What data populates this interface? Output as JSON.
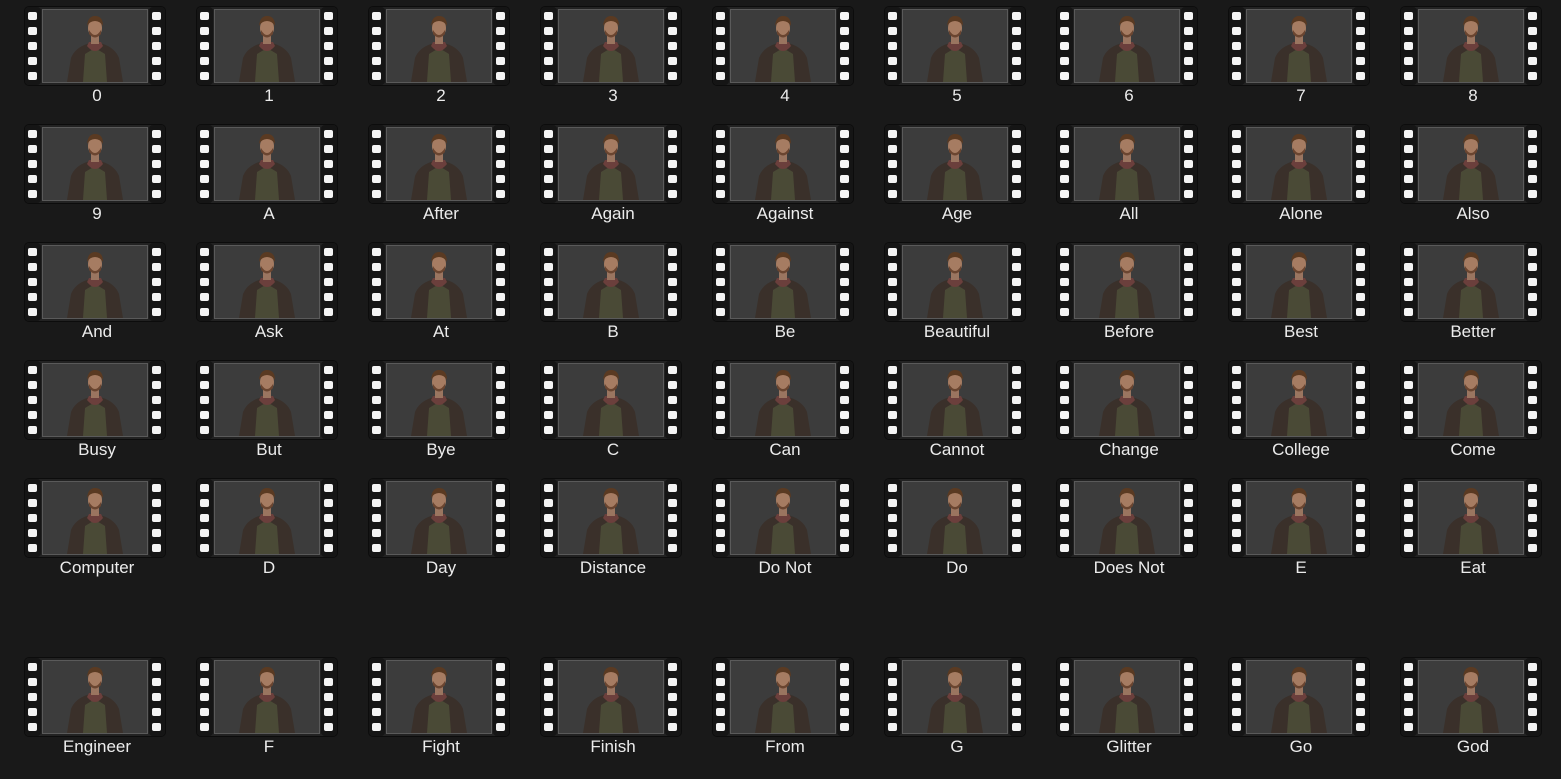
{
  "view": {
    "background": "#191919",
    "item_icon": "video-file-icon",
    "thumbnail_subject": "3D avatar figure"
  },
  "rows": [
    [
      "0",
      "1",
      "2",
      "3",
      "4",
      "5",
      "6",
      "7",
      "8"
    ],
    [
      "9",
      "A",
      "After",
      "Again",
      "Against",
      "Age",
      "All",
      "Alone",
      "Also"
    ],
    [
      "And",
      "Ask",
      "At",
      "B",
      "Be",
      "Beautiful",
      "Before",
      "Best",
      "Better"
    ],
    [
      "Busy",
      "But",
      "Bye",
      "C",
      "Can",
      "Cannot",
      "Change",
      "College",
      "Come"
    ],
    [
      "Computer",
      "D",
      "Day",
      "Distance",
      "Do Not",
      "Do",
      "Does Not",
      "E",
      "Eat"
    ],
    [
      "Engineer",
      "F",
      "Fight",
      "Finish",
      "From",
      "G",
      "Glitter",
      "Go",
      "God"
    ]
  ]
}
